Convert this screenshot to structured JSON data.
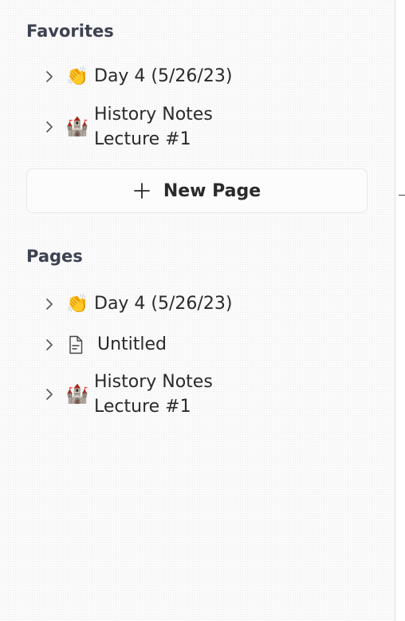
{
  "favorites": {
    "title": "Favorites",
    "items": [
      {
        "emoji": "👏",
        "label": "Day 4 (5/26/23)"
      },
      {
        "emoji": "🏰",
        "label": "History Notes\nLecture #1"
      }
    ]
  },
  "new_page": {
    "label": "New Page"
  },
  "pages": {
    "title": "Pages",
    "items": [
      {
        "emoji": "👏",
        "label": "Day 4 (5/26/23)"
      },
      {
        "icon": "document-icon",
        "label": "Untitled"
      },
      {
        "emoji": "🏰",
        "label": "History Notes\nLecture #1"
      }
    ]
  },
  "colors": {
    "section_title": "#3d4250",
    "text": "#2a2a2a",
    "divider": "#dcdde1"
  }
}
